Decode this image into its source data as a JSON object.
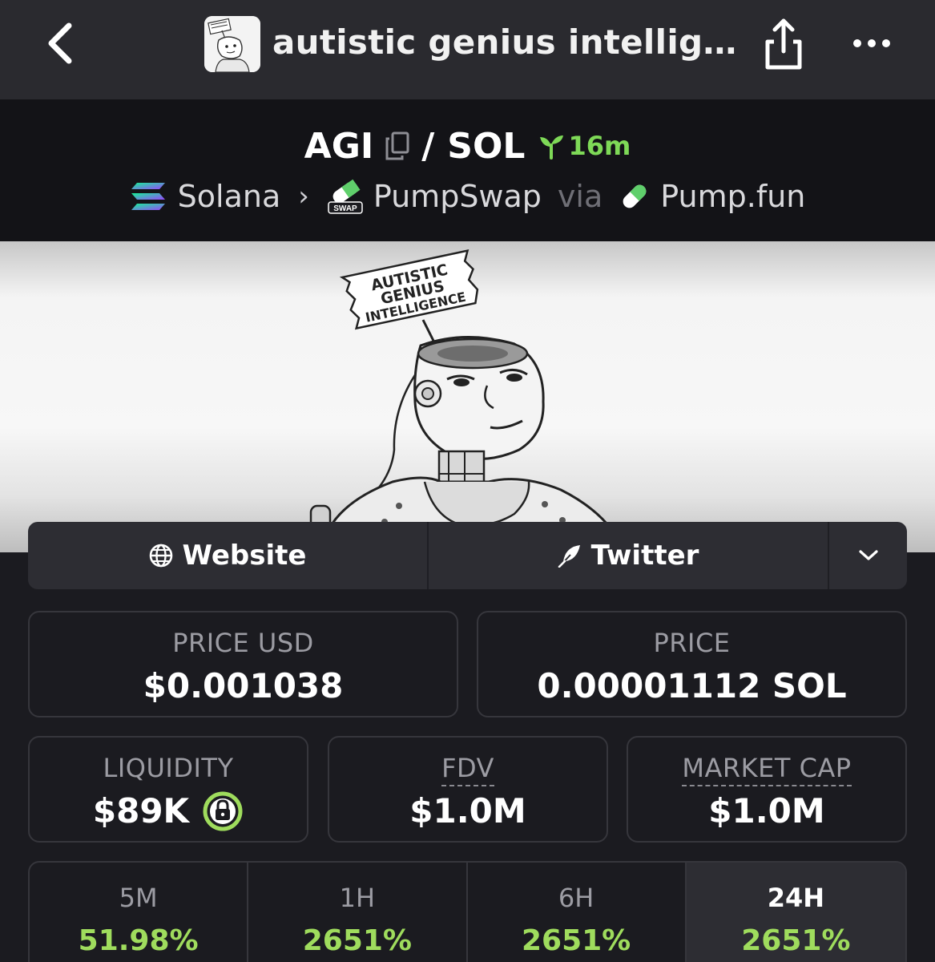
{
  "nav": {
    "title": "autistic genius intellig…",
    "avatar_sign_text": "AUTISTIC GENIUS"
  },
  "pair": {
    "base": "AGI",
    "separator": "/",
    "quote": "SOL",
    "age": "16m",
    "chain": "Solana",
    "dex": "PumpSwap",
    "dex_badge": "SWAP",
    "via": "via",
    "launchpad": "Pump.fun"
  },
  "banner": {
    "sign_line1": "AUTISTIC",
    "sign_line2": "GENIUS",
    "sign_line3": "INTELLIGENCE"
  },
  "links": {
    "website": "Website",
    "twitter": "Twitter"
  },
  "stats": {
    "price_usd_label": "PRICE USD",
    "price_usd_value": "$0.001038",
    "price_label": "PRICE",
    "price_value": "0.00001112 SOL",
    "liquidity_label": "LIQUIDITY",
    "liquidity_value": "$89K",
    "fdv_label": "FDV",
    "fdv_value": "$1.0M",
    "mcap_label": "MARKET CAP",
    "mcap_value": "$1.0M"
  },
  "timeframes": [
    {
      "label": "5M",
      "value": "51.98%"
    },
    {
      "label": "1H",
      "value": "2651%"
    },
    {
      "label": "6H",
      "value": "2651%"
    },
    {
      "label": "24H",
      "value": "2651%"
    }
  ],
  "colors": {
    "positive": "#9fdc5d",
    "age_green": "#7ed957",
    "page_bg": "#1b1b20",
    "nav_bg": "#2a2a2f"
  }
}
